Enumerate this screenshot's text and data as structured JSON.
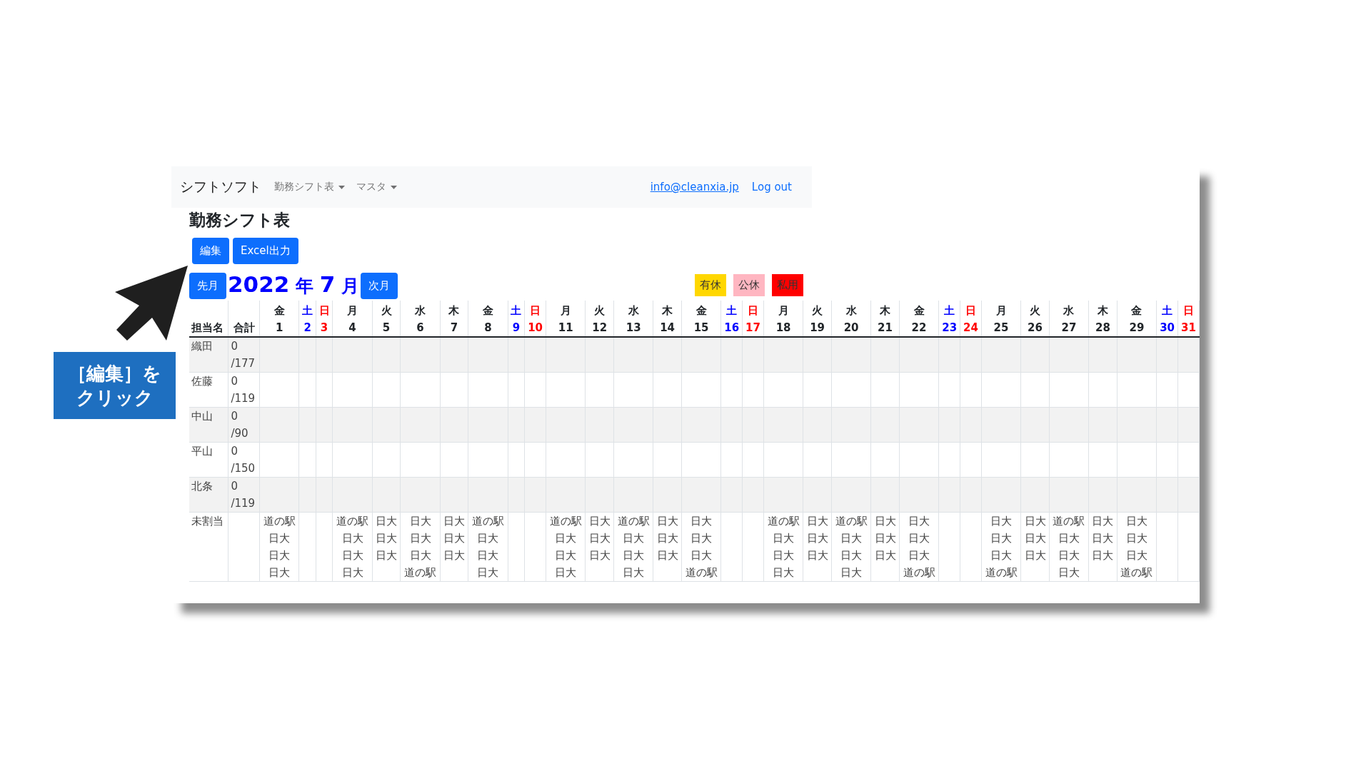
{
  "navbar": {
    "brand": "シフトソフト",
    "menus": [
      {
        "label": "勤務シフト表"
      },
      {
        "label": "マスタ"
      }
    ],
    "user_email": "info@cleanxia.jp",
    "logout": "Log out"
  },
  "page_title": "勤務シフト表",
  "actions": [
    "編集",
    "Excel出力"
  ],
  "month_nav": {
    "prev": "先月",
    "year": "2022",
    "year_unit": "年",
    "month": "7",
    "month_unit": "月",
    "next": "次月"
  },
  "legend": [
    {
      "label": "有休",
      "color": "#ffd700"
    },
    {
      "label": "公休",
      "color": "#ffb6c1"
    },
    {
      "label": "私用",
      "color": "#ff0000"
    }
  ],
  "table": {
    "columns": [
      "担当名",
      "合計"
    ],
    "days": [
      {
        "weekday": "金",
        "date": "1",
        "kind": "weekday"
      },
      {
        "weekday": "土",
        "date": "2",
        "kind": "saturday"
      },
      {
        "weekday": "日",
        "date": "3",
        "kind": "sunday"
      },
      {
        "weekday": "月",
        "date": "4",
        "kind": "weekday"
      },
      {
        "weekday": "火",
        "date": "5",
        "kind": "weekday"
      },
      {
        "weekday": "水",
        "date": "6",
        "kind": "weekday"
      },
      {
        "weekday": "木",
        "date": "7",
        "kind": "weekday"
      },
      {
        "weekday": "金",
        "date": "8",
        "kind": "weekday"
      },
      {
        "weekday": "土",
        "date": "9",
        "kind": "saturday"
      },
      {
        "weekday": "日",
        "date": "10",
        "kind": "sunday"
      },
      {
        "weekday": "月",
        "date": "11",
        "kind": "weekday"
      },
      {
        "weekday": "火",
        "date": "12",
        "kind": "weekday"
      },
      {
        "weekday": "水",
        "date": "13",
        "kind": "weekday"
      },
      {
        "weekday": "木",
        "date": "14",
        "kind": "weekday"
      },
      {
        "weekday": "金",
        "date": "15",
        "kind": "weekday"
      },
      {
        "weekday": "土",
        "date": "16",
        "kind": "saturday"
      },
      {
        "weekday": "日",
        "date": "17",
        "kind": "sunday"
      },
      {
        "weekday": "月",
        "date": "18",
        "kind": "weekday"
      },
      {
        "weekday": "火",
        "date": "19",
        "kind": "weekday"
      },
      {
        "weekday": "水",
        "date": "20",
        "kind": "weekday"
      },
      {
        "weekday": "木",
        "date": "21",
        "kind": "weekday"
      },
      {
        "weekday": "金",
        "date": "22",
        "kind": "weekday"
      },
      {
        "weekday": "土",
        "date": "23",
        "kind": "saturday"
      },
      {
        "weekday": "日",
        "date": "24",
        "kind": "sunday"
      },
      {
        "weekday": "月",
        "date": "25",
        "kind": "weekday"
      },
      {
        "weekday": "火",
        "date": "26",
        "kind": "weekday"
      },
      {
        "weekday": "水",
        "date": "27",
        "kind": "weekday"
      },
      {
        "weekday": "木",
        "date": "28",
        "kind": "weekday"
      },
      {
        "weekday": "金",
        "date": "29",
        "kind": "weekday"
      },
      {
        "weekday": "土",
        "date": "30",
        "kind": "saturday"
      },
      {
        "weekday": "日",
        "date": "31",
        "kind": "sunday"
      }
    ],
    "rows": [
      {
        "name": "織田",
        "worked": "0",
        "required": "/177"
      },
      {
        "name": "佐藤",
        "worked": "0",
        "required": "/119"
      },
      {
        "name": "中山",
        "worked": "0",
        "required": "/90"
      },
      {
        "name": "平山",
        "worked": "0",
        "required": "/150"
      },
      {
        "name": "北条",
        "worked": "0",
        "required": "/119"
      }
    ],
    "unassigned": {
      "label": "未割当",
      "cells": [
        [
          "道の駅",
          "日大",
          "日大",
          "日大"
        ],
        [],
        [],
        [
          "道の駅",
          "日大",
          "日大",
          "日大"
        ],
        [
          "日大",
          "日大",
          "日大"
        ],
        [
          "日大",
          "日大",
          "日大",
          "道の駅"
        ],
        [
          "日大",
          "日大",
          "日大"
        ],
        [
          "道の駅",
          "日大",
          "日大",
          "日大"
        ],
        [],
        [],
        [
          "道の駅",
          "日大",
          "日大",
          "日大"
        ],
        [
          "日大",
          "日大",
          "日大"
        ],
        [
          "道の駅",
          "日大",
          "日大",
          "日大"
        ],
        [
          "日大",
          "日大",
          "日大"
        ],
        [
          "日大",
          "日大",
          "日大",
          "道の駅"
        ],
        [],
        [],
        [
          "道の駅",
          "日大",
          "日大",
          "日大"
        ],
        [
          "日大",
          "日大",
          "日大"
        ],
        [
          "道の駅",
          "日大",
          "日大",
          "日大"
        ],
        [
          "日大",
          "日大",
          "日大"
        ],
        [
          "日大",
          "日大",
          "日大",
          "道の駅"
        ],
        [],
        [],
        [
          "日大",
          "日大",
          "日大",
          "道の駅"
        ],
        [
          "日大",
          "日大",
          "日大"
        ],
        [
          "道の駅",
          "日大",
          "日大",
          "日大"
        ],
        [
          "日大",
          "日大",
          "日大"
        ],
        [
          "日大",
          "日大",
          "日大",
          "道の駅"
        ],
        [],
        []
      ]
    }
  },
  "callout": {
    "text": "［編集］をクリック"
  }
}
